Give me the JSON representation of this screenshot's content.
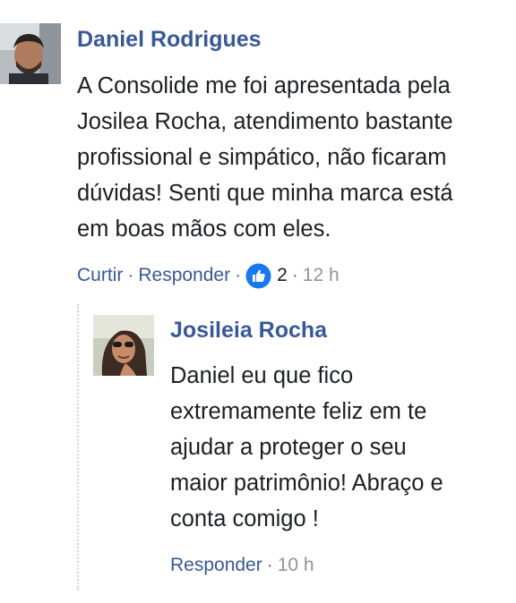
{
  "comment": {
    "author": "Daniel Rodrigues",
    "lines": [
      "A Consolide me foi apresentada pela",
      "Josilea Rocha, atendimento bastante",
      "profissional e simpático, não ficaram",
      "dúvidas! Senti que minha marca está",
      "em boas mãos com eles."
    ],
    "like_label": "Curtir",
    "reply_label": "Responder",
    "reaction_icon": "like-reaction-icon",
    "reaction_count": "2",
    "time": "12 h"
  },
  "reply": {
    "author": "Josileia Rocha",
    "lines": [
      "Daniel eu que fico",
      "extremamente feliz em te",
      "ajudar a proteger o seu",
      "maior patrimônio! Abraço e",
      "conta comigo !"
    ],
    "reply_label": "Responder",
    "time": "10 h"
  },
  "colors": {
    "name_link": "#385898",
    "like_blue": "#1877f2",
    "muted": "#90949c"
  }
}
